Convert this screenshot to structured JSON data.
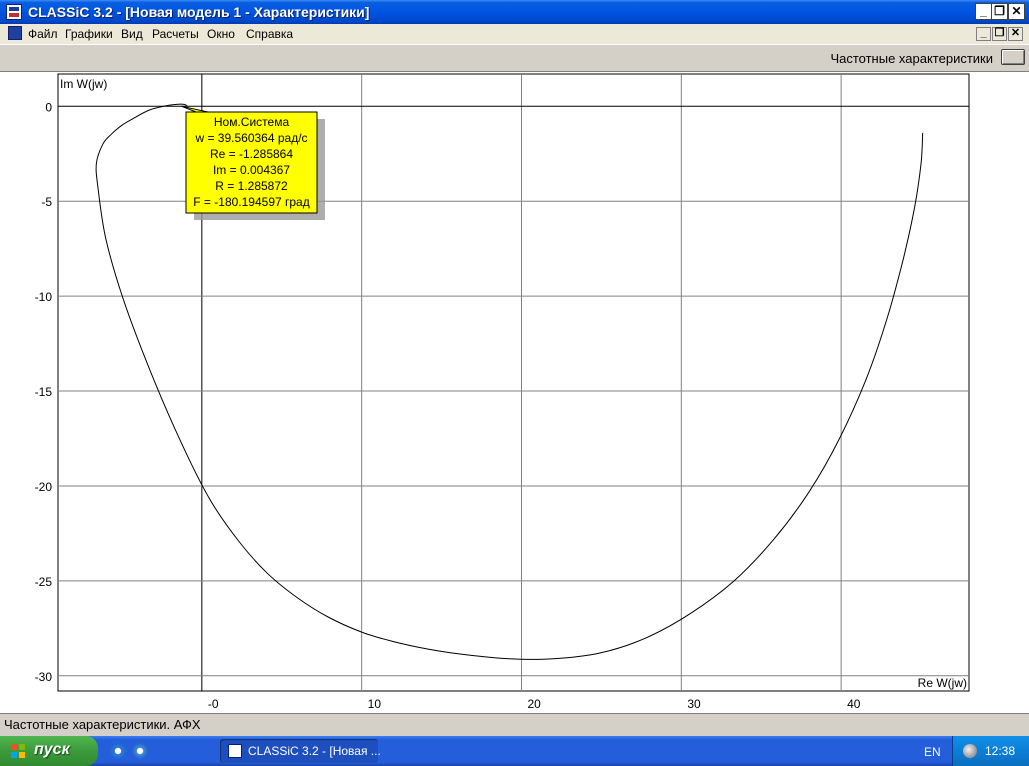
{
  "window": {
    "title": "CLASSiC 3.2 - [Новая модель 1 - Характеристики]",
    "minimize": "_",
    "maximize": "❐",
    "close": "✕"
  },
  "menu": {
    "items": [
      "Файл",
      "Графики",
      "Вид",
      "Расчеты",
      "Окно",
      "Справка"
    ]
  },
  "panel": {
    "label": "Частотные характеристики"
  },
  "chart_data": {
    "type": "line",
    "xlabel": "Re W(jw)",
    "ylabel": "Im W(jw)",
    "xlim": [
      -9,
      48
    ],
    "ylim": [
      -30.8,
      1.7
    ],
    "xticks": [
      {
        "value": 0,
        "label": "-0"
      },
      {
        "value": 10,
        "label": "10"
      },
      {
        "value": 20,
        "label": "20"
      },
      {
        "value": 30,
        "label": "30"
      },
      {
        "value": 40,
        "label": "40"
      }
    ],
    "yticks": [
      {
        "value": 0,
        "label": "0"
      },
      {
        "value": -5,
        "label": "-5"
      },
      {
        "value": -10,
        "label": "-10"
      },
      {
        "value": -15,
        "label": "-15"
      },
      {
        "value": -20,
        "label": "-20"
      },
      {
        "value": -25,
        "label": "-25"
      },
      {
        "value": -30,
        "label": "-30"
      }
    ],
    "grid": true,
    "series": [
      {
        "x": [
          45.1,
          45.0,
          44.6,
          43.9,
          42.9,
          41.6,
          39.9,
          38.0,
          35.8,
          33.3,
          30.6,
          27.8,
          24.9,
          22.0,
          19.2,
          16.6,
          14.2,
          12.0,
          10.0,
          7.9,
          6.0,
          4.1,
          2.3,
          0.5,
          -1.3,
          -3.2,
          -4.9,
          -6.0,
          -6.5,
          -6.6,
          -6.2,
          -5.7,
          -5.0,
          -4.2,
          -3.3,
          -2.4,
          -1.6,
          -1.1,
          -0.9
        ],
        "y": [
          -1.4,
          -3.0,
          -5.3,
          -8.0,
          -11.1,
          -14.3,
          -17.5,
          -20.3,
          -22.8,
          -25.0,
          -26.7,
          -28.0,
          -28.8,
          -29.1,
          -29.1,
          -28.9,
          -28.6,
          -28.2,
          -27.7,
          -26.9,
          -25.9,
          -24.6,
          -22.9,
          -20.7,
          -17.7,
          -14.0,
          -10.2,
          -7.0,
          -4.3,
          -3.0,
          -2.0,
          -1.5,
          -1.0,
          -0.6,
          -0.2,
          0.0,
          0.1,
          0.1,
          0.0
        ]
      }
    ]
  },
  "tooltip": {
    "lines": [
      "Ном.Система",
      "w = 39.560364 рад/с",
      "Re = -1.285864",
      "Im = 0.004367",
      "R = 1.285872",
      "F = -180.194597 град"
    ]
  },
  "status": {
    "text": "Частотные характеристики. АФХ"
  },
  "taskbar": {
    "start_label": "пуск",
    "task_label": "CLASSiC 3.2 - [Новая ...",
    "lang": "EN",
    "clock": "12:38"
  }
}
